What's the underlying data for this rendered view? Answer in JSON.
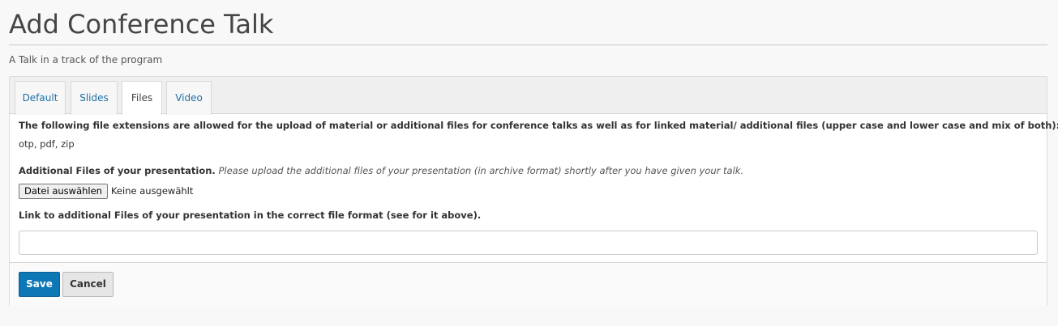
{
  "page": {
    "title": "Add Conference Talk",
    "subtitle": "A Talk in a track of the program"
  },
  "tabs": [
    {
      "label": "Default",
      "active": false
    },
    {
      "label": "Slides",
      "active": false
    },
    {
      "label": "Files",
      "active": true
    },
    {
      "label": "Video",
      "active": false
    }
  ],
  "files_tab": {
    "allowed_text": "The following file extensions are allowed for the upload of material or additional files for conference talks as well as for linked material/ additional files (upper case and lower case and mix of both):",
    "extensions": "otp, pdf, zip",
    "additional_files_label": "Additional Files of your presentation.",
    "additional_files_hint": "Please upload the additional files of your presentation (in archive format) shortly after you have given your talk.",
    "file_button_label": "Datei auswählen",
    "file_status": "Keine ausgewählt",
    "link_label": "Link to additional Files of your presentation in the correct file format (see for it above).",
    "link_value": ""
  },
  "footer": {
    "save_label": "Save",
    "cancel_label": "Cancel"
  },
  "colors": {
    "accent": "#0e77b6",
    "tab_link": "#1f6fa3"
  }
}
